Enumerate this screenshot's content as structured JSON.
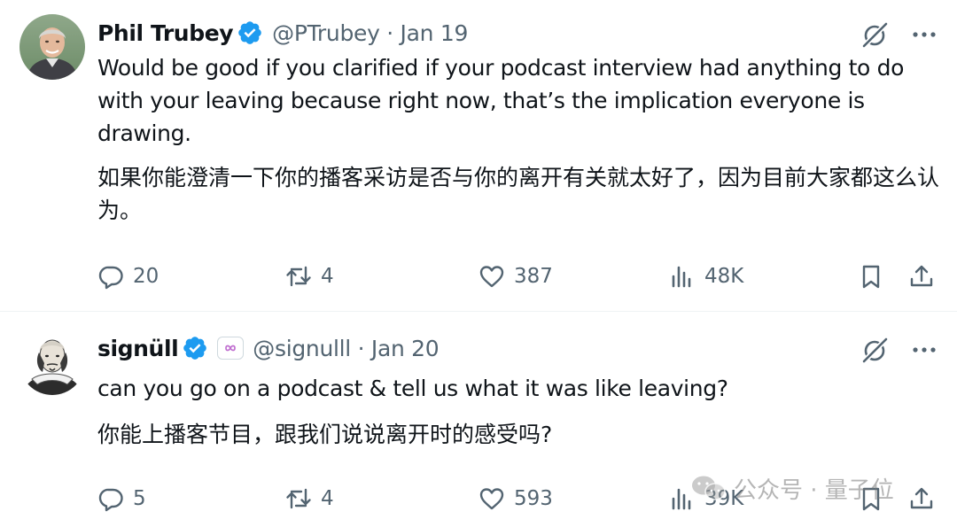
{
  "tweets": [
    {
      "author": {
        "name": "Phil Trubey",
        "handle": "@PTrubey",
        "date": "· Jan 19",
        "avatar": "avatar-photo"
      },
      "text_en": "Would be good if you clarified if your podcast interview had anything to do with your leaving because right now, that’s the implication everyone is drawing.",
      "text_zh": "如果你能澄清一下你的播客采访是否与你的离开有关就太好了，因为目前大家都这么认为。",
      "counts": {
        "replies": "20",
        "retweets": "4",
        "likes": "387",
        "views": "48K"
      }
    },
    {
      "author": {
        "name": "signüll",
        "handle": "@signulll",
        "date": "· Jan 20",
        "avatar": "avatar-shakespeare-portrait"
      },
      "text_en": "can you go on a podcast & tell us what it was like leaving?",
      "text_zh": "你能上播客节目，跟我们说说离开时的感受吗?",
      "counts": {
        "replies": "5",
        "retweets": "4",
        "likes": "593",
        "views": "39K"
      }
    }
  ],
  "watermark": {
    "text": "公众号 · 量子位",
    "icon": "wechat-icon"
  },
  "colors": {
    "text": "#0f1419",
    "secondary": "#536471",
    "verified": "#1d9bf0",
    "divider": "#eff3f4"
  }
}
